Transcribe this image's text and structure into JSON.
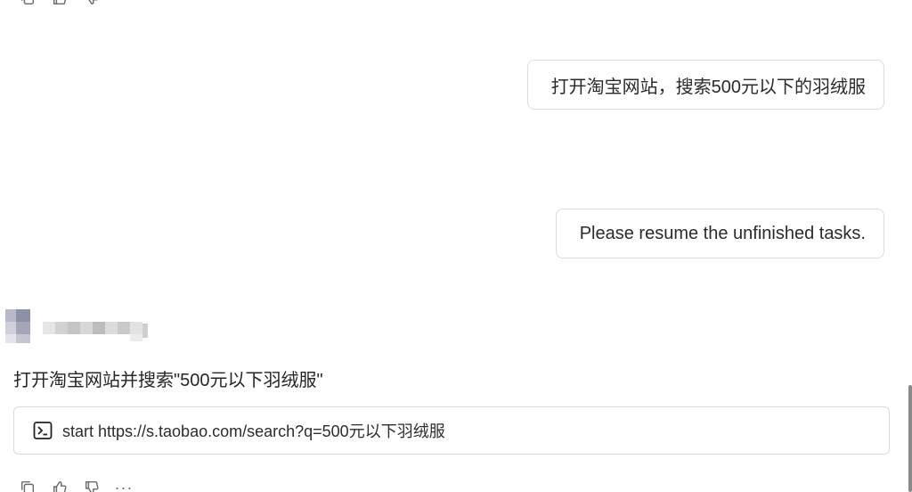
{
  "top_actions": {
    "icons": [
      "copy-icon",
      "thumbs-up-icon",
      "thumbs-down-icon"
    ]
  },
  "messages": {
    "user_1": "打开淘宝网站，搜索500元以下的羽绒服",
    "user_2": "Please resume the unfinished tasks.",
    "assistant_text": "打开淘宝网站并搜索\"500元以下羽绒服\"",
    "assistant_command": "start https://s.taobao.com/search?q=500元以下羽绒服"
  },
  "bottom_actions": {
    "icons": [
      "copy-icon",
      "thumbs-up-icon",
      "thumbs-down-icon",
      "more-icon"
    ],
    "more_label": "···"
  },
  "colors": {
    "border": "#dcdcdc",
    "text": "#262626",
    "icon": "#6b6b6b"
  }
}
